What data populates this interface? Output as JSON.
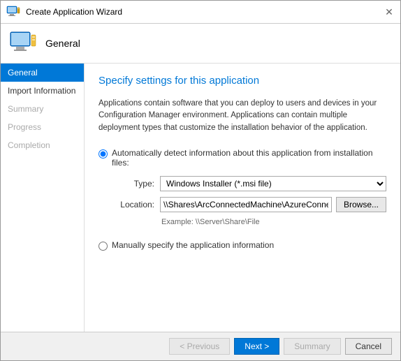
{
  "window": {
    "title": "Create Application Wizard",
    "close_label": "✕"
  },
  "header": {
    "title": "General"
  },
  "sidebar": {
    "items": [
      {
        "id": "general",
        "label": "General",
        "state": "active"
      },
      {
        "id": "import-information",
        "label": "Import Information",
        "state": "normal"
      },
      {
        "id": "summary",
        "label": "Summary",
        "state": "disabled"
      },
      {
        "id": "progress",
        "label": "Progress",
        "state": "disabled"
      },
      {
        "id": "completion",
        "label": "Completion",
        "state": "disabled"
      }
    ]
  },
  "main": {
    "page_title": "Specify settings for this application",
    "description": "Applications contain software that you can deploy to users and devices in your Configuration Manager environment. Applications can contain multiple deployment types that customize the installation behavior of the application.",
    "radio_auto_label": "Automatically detect information about this application from installation files:",
    "form": {
      "type_label": "Type:",
      "type_value": "Windows Installer (*.msi file)",
      "location_label": "Location:",
      "location_value": "\\\\Shares\\ArcConnectedMachine\\AzureConnectedMachineAgent.msi",
      "browse_label": "Browse...",
      "example_label": "Example: \\\\Server\\Share\\File"
    },
    "radio_manual_label": "Manually specify the application information"
  },
  "footer": {
    "previous_label": "< Previous",
    "next_label": "Next >",
    "summary_label": "Summary",
    "cancel_label": "Cancel"
  }
}
